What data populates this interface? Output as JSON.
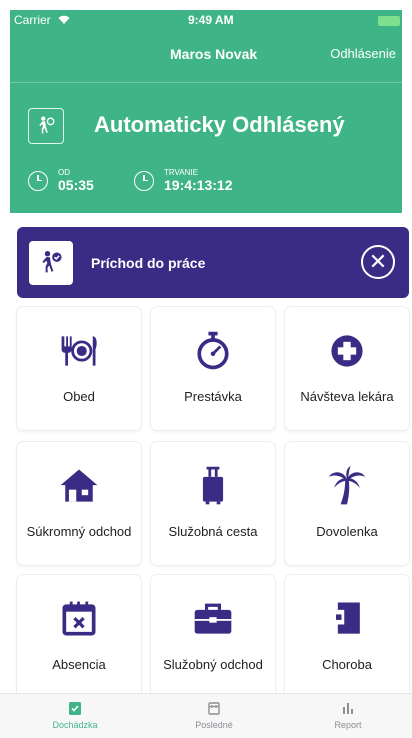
{
  "status_bar": {
    "carrier": "Carrier",
    "time": "9:49 AM"
  },
  "nav": {
    "user": "Maros Novak",
    "logout": "Odhlásenie"
  },
  "status": {
    "title": "Automaticky Odhlásený",
    "from_label": "OD",
    "from_value": "05:35",
    "duration_label": "TRVANIE",
    "duration_value": "19:4:13:12"
  },
  "arrival": {
    "label": "Príchod do práce"
  },
  "tiles": [
    {
      "label": "Obed",
      "icon": "plate-cutlery-icon"
    },
    {
      "label": "Prestávka",
      "icon": "stopwatch-icon"
    },
    {
      "label": "Návšteva lekára",
      "icon": "medical-cross-icon"
    },
    {
      "label": "Súkromný odchod",
      "icon": "house-icon"
    },
    {
      "label": "Služobná cesta",
      "icon": "suitcase-icon"
    },
    {
      "label": "Dovolenka",
      "icon": "palm-tree-icon"
    },
    {
      "label": "Absencia",
      "icon": "calendar-x-icon"
    },
    {
      "label": "Služobný odchod",
      "icon": "briefcase-icon"
    },
    {
      "label": "Choroba",
      "icon": "sick-note-icon"
    }
  ],
  "tabs": [
    {
      "label": "Dochádzka",
      "active": true
    },
    {
      "label": "Posledné",
      "active": false
    },
    {
      "label": "Report",
      "active": false
    }
  ],
  "colors": {
    "green": "#3fb587",
    "purple": "#3a2b85"
  }
}
